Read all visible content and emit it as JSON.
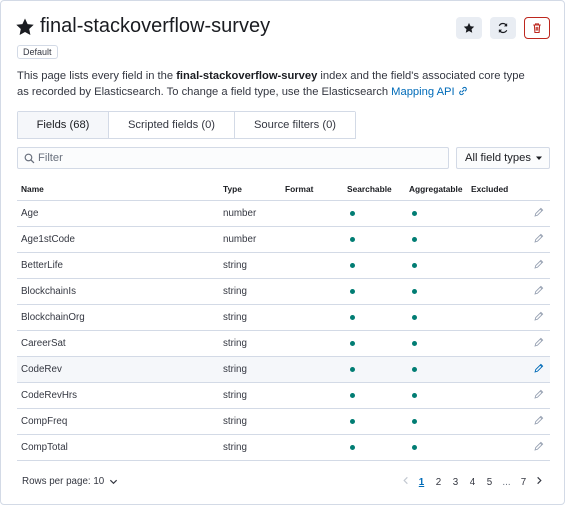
{
  "header": {
    "title": "final-stackoverflow-survey",
    "badge": "Default"
  },
  "description": {
    "part1": "This page lists every field in the ",
    "index_name": "final-stackoverflow-survey",
    "part2": " index and the field's associated core type as recorded by Elasticsearch. To change a field type, use the Elasticsearch ",
    "link": "Mapping API"
  },
  "tabs": [
    {
      "label": "Fields (68)",
      "selected": true
    },
    {
      "label": "Scripted fields (0)",
      "selected": false
    },
    {
      "label": "Source filters (0)",
      "selected": false
    }
  ],
  "search": {
    "placeholder": "Filter"
  },
  "filter_select": {
    "value": "All field types"
  },
  "table": {
    "columns": [
      "Name",
      "Type",
      "Format",
      "Searchable",
      "Aggregatable",
      "Excluded"
    ],
    "rows": [
      {
        "name": "Age",
        "type": "number",
        "format": "",
        "searchable": true,
        "aggregatable": true,
        "excluded": false
      },
      {
        "name": "Age1stCode",
        "type": "number",
        "format": "",
        "searchable": true,
        "aggregatable": true,
        "excluded": false
      },
      {
        "name": "BetterLife",
        "type": "string",
        "format": "",
        "searchable": true,
        "aggregatable": true,
        "excluded": false
      },
      {
        "name": "BlockchainIs",
        "type": "string",
        "format": "",
        "searchable": true,
        "aggregatable": true,
        "excluded": false
      },
      {
        "name": "BlockchainOrg",
        "type": "string",
        "format": "",
        "searchable": true,
        "aggregatable": true,
        "excluded": false
      },
      {
        "name": "CareerSat",
        "type": "string",
        "format": "",
        "searchable": true,
        "aggregatable": true,
        "excluded": false
      },
      {
        "name": "CodeRev",
        "type": "string",
        "format": "",
        "searchable": true,
        "aggregatable": true,
        "excluded": false
      },
      {
        "name": "CodeRevHrs",
        "type": "string",
        "format": "",
        "searchable": true,
        "aggregatable": true,
        "excluded": false
      },
      {
        "name": "CompFreq",
        "type": "string",
        "format": "",
        "searchable": true,
        "aggregatable": true,
        "excluded": false
      },
      {
        "name": "CompTotal",
        "type": "string",
        "format": "",
        "searchable": true,
        "aggregatable": true,
        "excluded": false
      }
    ]
  },
  "footer": {
    "rows_per_page": "Rows per page: 10",
    "pages": [
      "1",
      "2",
      "3",
      "4",
      "5",
      "...",
      "7"
    ],
    "active_page": "1"
  },
  "colors": {
    "accent": "#006bb8",
    "dot": "#017d73",
    "danger": "#bd271e"
  }
}
